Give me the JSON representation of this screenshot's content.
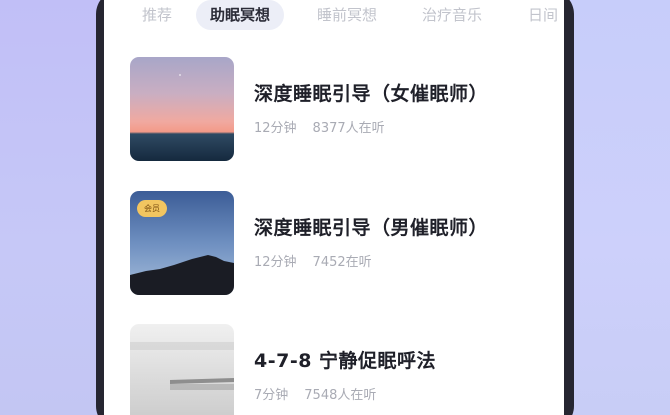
{
  "tabs": [
    {
      "label": "推荐"
    },
    {
      "label": "助眠冥想"
    },
    {
      "label": "睡前冥想"
    },
    {
      "label": "治疗音乐"
    },
    {
      "label": "日间"
    }
  ],
  "active_tab": "助眠冥想",
  "items": [
    {
      "title": "深度睡眠引导（女催眠师）",
      "duration": "12分钟",
      "listeners": "8377人在听",
      "badge": ""
    },
    {
      "title": "深度睡眠引导（男催眠师）",
      "duration": "12分钟",
      "listeners": "7452在听",
      "badge": "会员"
    },
    {
      "title": "4-7-8 宁静促眠呼法",
      "duration": "7分钟",
      "listeners": "7548人在听",
      "badge": ""
    }
  ],
  "colors": {
    "background": "#cdd0fb",
    "phone_frame": "#262631",
    "tab_active_bg": "#eceef7",
    "tab_inactive_text": "#c2c4cc",
    "title_text": "#1f2029",
    "meta_text": "#a9abb4",
    "badge_bg": "#f2c560"
  }
}
